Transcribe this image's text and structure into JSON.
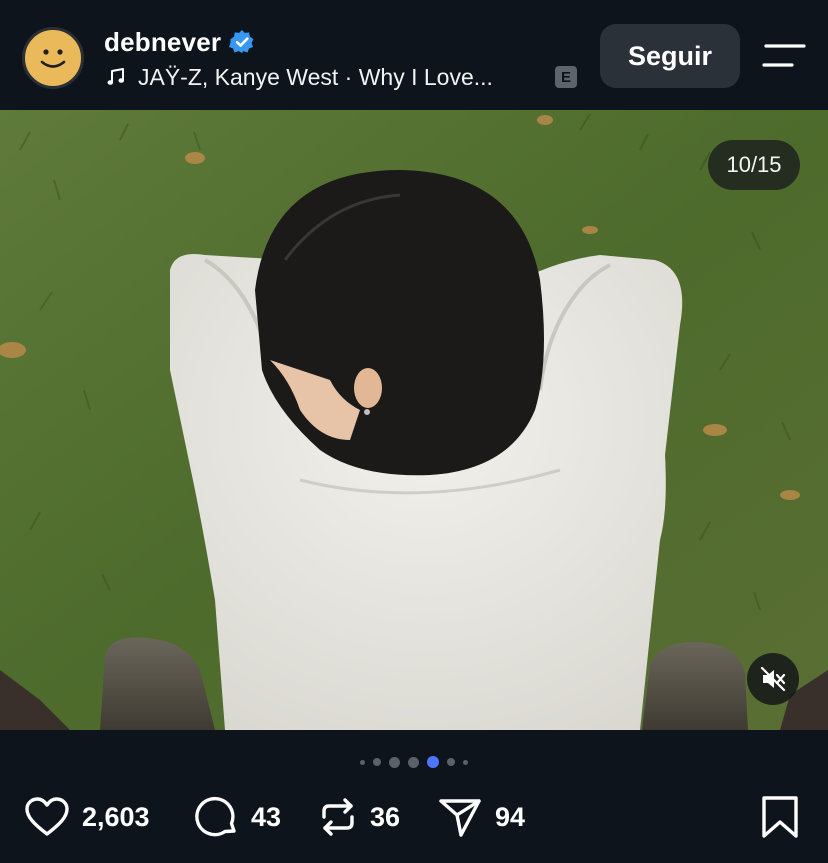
{
  "post": {
    "username": "debnever",
    "verified": true,
    "music": "JAŸ-Z, Kanye West · Why I Love...",
    "explicit_label": "E",
    "follow_label": "Seguir",
    "image_counter": "10/15",
    "carousel": {
      "dots": 7,
      "active_dot": 4
    }
  },
  "actions": {
    "likes": "2,603",
    "comments": "43",
    "reposts": "36",
    "shares": "94"
  },
  "colors": {
    "background": "#0e141c",
    "button": "#2b3139",
    "accent": "#4f74ff",
    "verified": "#3897f0",
    "avatar": "#e9b95a"
  },
  "icons": [
    "smiley-avatar",
    "verified-badge-icon",
    "music-note-icon",
    "menu-icon",
    "mute-icon",
    "heart-icon",
    "comment-icon",
    "repost-icon",
    "send-icon",
    "bookmark-icon"
  ]
}
